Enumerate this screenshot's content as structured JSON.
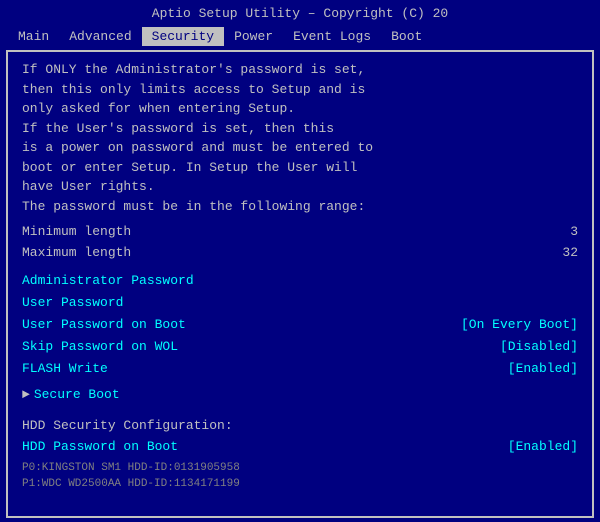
{
  "titleBar": {
    "text": "Aptio Setup Utility – Copyright (C) 20"
  },
  "nav": {
    "items": [
      {
        "label": "Main",
        "active": false
      },
      {
        "label": "Advanced",
        "active": false
      },
      {
        "label": "Security",
        "active": true
      },
      {
        "label": "Power",
        "active": false
      },
      {
        "label": "Event Logs",
        "active": false
      },
      {
        "label": "Boot",
        "active": false
      }
    ]
  },
  "description": {
    "lines": [
      "If ONLY the Administrator's password is set,",
      "then this only limits access to Setup and is",
      "only asked for when entering Setup.",
      "If the User's password is set, then this",
      "is a power on password and must be entered to",
      "boot or enter Setup. In Setup the User will",
      "have User rights.",
      "The password must be in the following range:"
    ]
  },
  "fields": [
    {
      "label": "Minimum length",
      "value": "3"
    },
    {
      "label": "Maximum length",
      "value": "32"
    }
  ],
  "menuItems": [
    {
      "label": "Administrator Password",
      "value": ""
    },
    {
      "label": "User Password",
      "value": ""
    },
    {
      "label": "User Password on Boot",
      "value": "[On Every Boot]"
    },
    {
      "label": "Skip Password on WOL",
      "value": "[Disabled]"
    },
    {
      "label": "FLASH Write",
      "value": "[Enabled]"
    }
  ],
  "submenu": {
    "label": "Secure Boot"
  },
  "hddSection": {
    "header": "HDD Security Configuration:",
    "item": {
      "label": "HDD Password on Boot",
      "value": "[Enabled]"
    }
  },
  "bottomItems": [
    "P0:KINGSTON SM1  HDD-ID:0131905958",
    "P1:WDC WD2500AA  HDD-ID:1134171199"
  ]
}
